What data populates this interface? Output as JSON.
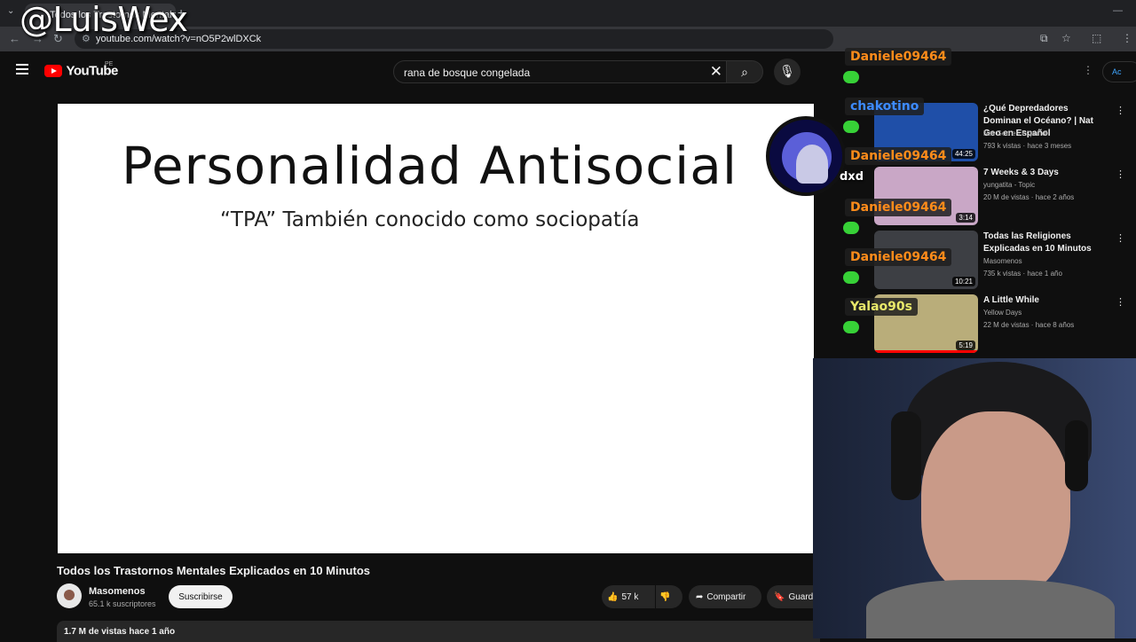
{
  "browser": {
    "tab_title": "Todos los Trastornos Mentales Explicados en 10 Minutos",
    "url": "youtube.com/watch?v=nO5P2wlDXCk"
  },
  "overlay": {
    "watermark": "@LuisWex"
  },
  "youtube": {
    "logo_text": "YouTube",
    "country_code": "PE",
    "search": {
      "query": "rana de bosque congelada"
    },
    "signin_label": "Ac"
  },
  "video": {
    "slide_title": "Personalidad Antisocial",
    "slide_subtitle": "“TPA” También conocido como sociopatía",
    "title": "Todos los Trastornos Mentales Explicados en 10 Minutos",
    "channel_name": "Masomenos",
    "subscribers": "65.1 k suscriptores",
    "subscribe_label": "Suscribirse",
    "likes": "57 k",
    "share_label": "Compartir",
    "save_label": "Guard",
    "views_date": "1.7 M de vistas  hace 1 año"
  },
  "recommended": [
    {
      "title": "¿Qué Depredadores Dominan el Océano? | Nat Geo en Español",
      "channel": "Nat Geo en Español",
      "meta": "793 k vistas · hace 3 meses",
      "duration": "44:25",
      "thumb_color": "#1f4fa8"
    },
    {
      "title": "7 Weeks & 3 Days",
      "channel": "yungatita - Topic",
      "meta": "20 M de vistas · hace 2 años",
      "duration": "3:14",
      "thumb_color": "#c9a7c6"
    },
    {
      "title": "Todas las Religiones Explicadas en 10 Minutos",
      "channel": "Masomenos",
      "meta": "735 k vistas · hace 1 año",
      "duration": "10:21",
      "thumb_color": "#3d3f44"
    },
    {
      "title": "A Little While",
      "channel": "Yellow Days",
      "meta": "22 M de vistas · hace 8 años",
      "duration": "5:19",
      "thumb_color": "#b9ad7a"
    }
  ],
  "chat": [
    {
      "user": "Daniele09464",
      "color": "#ff8c1a"
    },
    {
      "user": "chakotino",
      "color": "#3d8bff"
    },
    {
      "user": "Daniele09464",
      "color": "#ff8c1a"
    },
    {
      "user": "Daniele09464",
      "color": "#ff8c1a"
    },
    {
      "user": "Daniele09464",
      "color": "#ff8c1a"
    },
    {
      "user": "Yalao90s",
      "color": "#e8e86a"
    }
  ],
  "chat_message": "dxd",
  "colors": {
    "youtube_red": "#ff0000",
    "background": "#0f0f0f"
  }
}
